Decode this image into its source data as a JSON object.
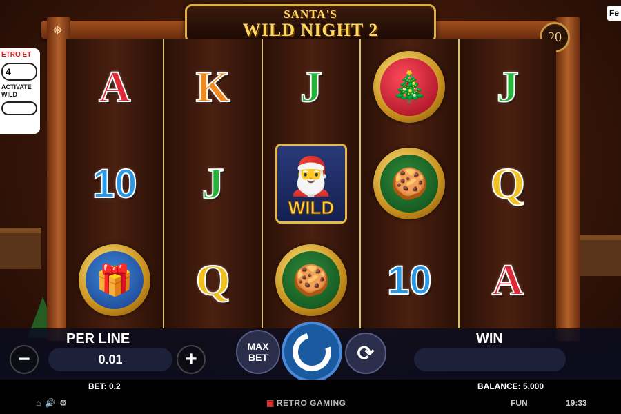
{
  "game": {
    "title_top": "SANTA'S",
    "title_bottom": "WILD NIGHT 2",
    "lines": "20"
  },
  "side_panel": {
    "header": "ETRO ET",
    "value": "4",
    "text": "ACTIVATE WILD"
  },
  "corner_tab": "Fe",
  "reels": [
    [
      {
        "type": "letter",
        "text": "A",
        "color": "red"
      },
      {
        "type": "letter",
        "text": "10",
        "color": "blue"
      },
      {
        "type": "medal",
        "icon": "gift-icon",
        "inner": "gift",
        "glyph": "🎁"
      }
    ],
    [
      {
        "type": "letter",
        "text": "K",
        "color": "orange"
      },
      {
        "type": "letter",
        "text": "J",
        "color": "green"
      },
      {
        "type": "letter",
        "text": "Q",
        "color": "gold"
      }
    ],
    [
      {
        "type": "letter",
        "text": "J",
        "color": "green"
      },
      {
        "type": "wild",
        "icon": "santa-icon",
        "text": "WILD",
        "glyph": "🎅"
      },
      {
        "type": "medal",
        "icon": "gingerbread-icon",
        "inner": "ginger",
        "glyph": "🍪"
      }
    ],
    [
      {
        "type": "medal",
        "icon": "ornament-icon",
        "inner": "ornament",
        "glyph": "🎄"
      },
      {
        "type": "medal",
        "icon": "gingerbread-icon",
        "inner": "ginger",
        "glyph": "🍪"
      },
      {
        "type": "letter",
        "text": "10",
        "color": "blue"
      }
    ],
    [
      {
        "type": "letter",
        "text": "J",
        "color": "green"
      },
      {
        "type": "letter",
        "text": "Q",
        "color": "gold"
      },
      {
        "type": "letter",
        "text": "A",
        "color": "red"
      }
    ]
  ],
  "controls": {
    "per_line_label": "PER LINE",
    "per_line_value": "0.01",
    "minus": "−",
    "plus": "+",
    "max_bet_line1": "MAX",
    "max_bet_line2": "BET",
    "autoplay_glyph": "⟳",
    "win_label": "WIN"
  },
  "status": {
    "bet": "BET: 0.2",
    "balance": "BALANCE: 5,000",
    "mode": "FUN",
    "time": "19:33",
    "brand": "RETRO GAMING"
  }
}
